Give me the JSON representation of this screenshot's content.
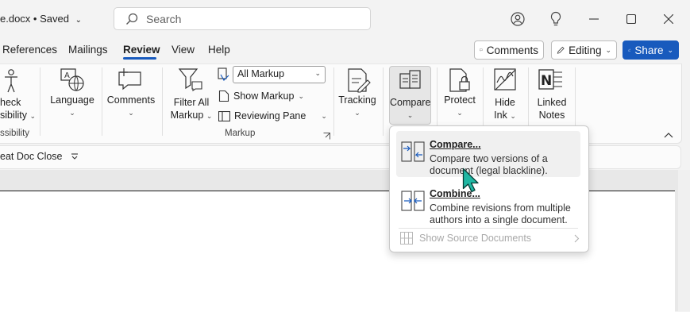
{
  "titlebar": {
    "doc_title": "e.docx • Saved",
    "search_placeholder": "Search"
  },
  "tabs": [
    {
      "label": "References"
    },
    {
      "label": "Mailings"
    },
    {
      "label": "Review",
      "selected": true
    },
    {
      "label": "View"
    },
    {
      "label": "Help"
    }
  ],
  "header_buttons": {
    "comments": "Comments",
    "editing": "Editing",
    "share": "Share"
  },
  "ribbon": {
    "accessibility_line1": "heck",
    "accessibility_line2": "sibility",
    "accessibility_group": "ssibility",
    "language": "Language",
    "comments": "Comments",
    "filter_line1": "Filter All",
    "filter_line2": "Markup",
    "markup_value": "All Markup",
    "show_markup": "Show Markup",
    "reviewing_pane": "Reviewing Pane",
    "markup_group": "Markup",
    "tracking": "Tracking",
    "compare": "Compare",
    "protect": "Protect",
    "hide_line1": "Hide",
    "hide_line2": "Ink",
    "linked_line1": "Linked",
    "linked_line2": "Notes"
  },
  "quickbar": {
    "item": "eat Doc Close"
  },
  "compare_menu": {
    "compare_title": "Compare...",
    "compare_desc": "Compare two versions of a document (legal blackline).",
    "combine_title": "Combine...",
    "combine_desc": "Combine revisions from multiple authors into a single document.",
    "show_source": "Show Source Documents"
  },
  "colors": {
    "accent": "#185abd",
    "cursor": "#1fb7a3"
  }
}
